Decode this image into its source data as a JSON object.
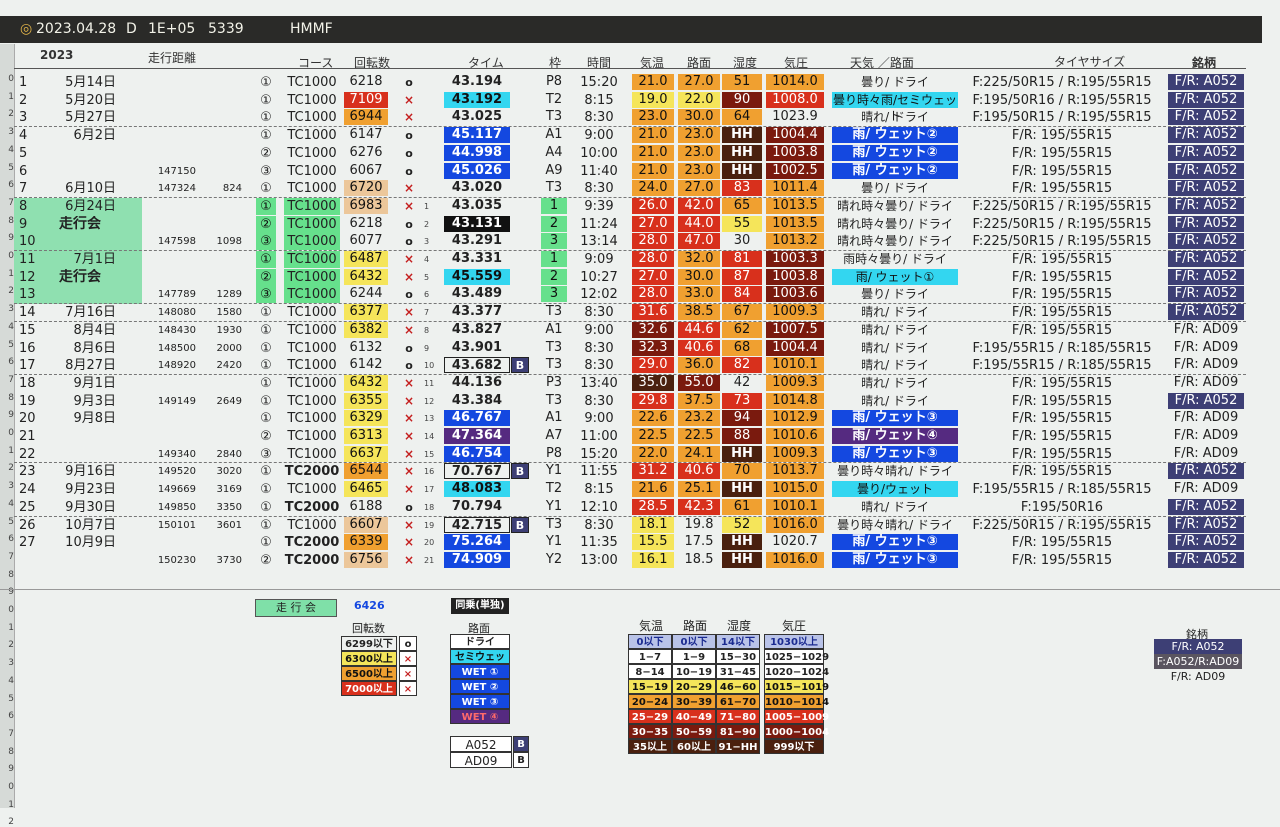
{
  "titlebar": {
    "date": "2023.04.28",
    "mode": "D",
    "value": "1E+05",
    "count": "5339",
    "car": "HMMF"
  },
  "headers": {
    "year": "2023",
    "distance": "走行距離",
    "course": "コース",
    "rpm": "回転数",
    "time": "タイム",
    "frame": "枠",
    "clock": "時間",
    "temp": "気温",
    "road": "路面",
    "humidity": "湿度",
    "pressure": "気圧",
    "weather": "天気 ／路面",
    "tire": "タイヤサイズ",
    "brand": "銘柄"
  },
  "colors": {
    "cyan": "#33d6f0",
    "blue": "#1448e0",
    "navy": "#3d3f75",
    "green": "#66e08c",
    "yellow": "#f5e55a",
    "orange": "#f0a030",
    "red": "#d8301c",
    "darkred": "#7a1a0e",
    "brown": "#4a200e",
    "purple": "#552a80",
    "black": "#111111",
    "tan": "#ecc79a"
  },
  "runs": [
    {
      "no": "1",
      "date": "5月14日",
      "dist": "",
      "dd": "",
      "lap": "①",
      "course": "TC1000",
      "rpm": "6218",
      "rpmc": "none",
      "mk": "o",
      "idx": "",
      "time": "43.194",
      "tc": "none",
      "b": "",
      "fr": "P8",
      "clock": "15:20",
      "temp": "21.0",
      "tpc": "orange",
      "road": "27.0",
      "rdc": "orange",
      "hum": "51",
      "hmc": "orange",
      "pres": "1014.0",
      "prc": "orange",
      "wx": "曇り/ ドライ",
      "wxc": "none",
      "tire": "F:225/50R15 / R:195/55R15",
      "brand": "F/R: A052",
      "bc": "navy"
    },
    {
      "no": "2",
      "date": "5月20日",
      "dist": "",
      "dd": "",
      "lap": "①",
      "course": "TC1000",
      "rpm": "7109",
      "rpmc": "red",
      "mk": "x",
      "idx": "",
      "time": "43.192",
      "tc": "cyan",
      "b": "",
      "fr": "T2",
      "clock": "8:15",
      "temp": "19.0",
      "tpc": "yellow",
      "road": "22.0",
      "rdc": "yellow",
      "hum": "90",
      "hmc": "darkred",
      "pres": "1008.0",
      "prc": "red",
      "wx": "曇り時々雨/セミウェット",
      "wxc": "cyan",
      "tire": "F:195/50R16 / R:195/55R15",
      "brand": "F/R: A052",
      "bc": "navy"
    },
    {
      "no": "3",
      "date": "5月27日",
      "dist": "",
      "dd": "",
      "lap": "①",
      "course": "TC1000",
      "rpm": "6944",
      "rpmc": "orange",
      "mk": "x",
      "idx": "",
      "time": "43.025",
      "tc": "none",
      "b": "",
      "fr": "T3",
      "clock": "8:30",
      "temp": "23.0",
      "tpc": "orange",
      "road": "30.0",
      "rdc": "orange",
      "hum": "64",
      "hmc": "orange",
      "pres": "1023.9",
      "prc": "none",
      "wx": "晴れ/ ドライ",
      "wxc": "none",
      "tire": "F:195/50R15 / R:195/55R15",
      "brand": "F/R: A052",
      "bc": "navy"
    },
    {
      "no": "4",
      "date": "6月2日",
      "dist": "",
      "dd": "",
      "lap": "①",
      "course": "TC1000",
      "rpm": "6147",
      "rpmc": "none",
      "mk": "o",
      "idx": "",
      "time": "45.117",
      "tc": "blue",
      "b": "",
      "fr": "A1",
      "clock": "9:00",
      "temp": "21.0",
      "tpc": "orange",
      "road": "23.0",
      "rdc": "orange",
      "hum": "HH",
      "hmc": "brown",
      "pres": "1004.4",
      "prc": "darkred",
      "wx": "雨/ ウェット②",
      "wxc": "blue",
      "tire": "F/R: 195/55R15",
      "brand": "F/R: A052",
      "bc": "navy"
    },
    {
      "no": "5",
      "date": "",
      "dist": "",
      "dd": "",
      "lap": "②",
      "course": "TC1000",
      "rpm": "6276",
      "rpmc": "none",
      "mk": "o",
      "idx": "",
      "time": "44.998",
      "tc": "blue",
      "b": "",
      "fr": "A4",
      "clock": "10:00",
      "temp": "21.0",
      "tpc": "orange",
      "road": "23.0",
      "rdc": "orange",
      "hum": "HH",
      "hmc": "brown",
      "pres": "1003.8",
      "prc": "darkred",
      "wx": "雨/ ウェット②",
      "wxc": "blue",
      "tire": "F/R: 195/55R15",
      "brand": "F/R: A052",
      "bc": "navy"
    },
    {
      "no": "6",
      "date": "",
      "dist": "147150",
      "dd": "",
      "lap": "③",
      "course": "TC1000",
      "rpm": "6067",
      "rpmc": "none",
      "mk": "o",
      "idx": "",
      "time": "45.026",
      "tc": "blue",
      "b": "",
      "fr": "A9",
      "clock": "11:40",
      "temp": "21.0",
      "tpc": "orange",
      "road": "23.0",
      "rdc": "orange",
      "hum": "HH",
      "hmc": "brown",
      "pres": "1002.5",
      "prc": "darkred",
      "wx": "雨/ ウェット②",
      "wxc": "blue",
      "tire": "F/R: 195/55R15",
      "brand": "F/R: A052",
      "bc": "navy"
    },
    {
      "no": "7",
      "date": "6月10日",
      "dist": "147324",
      "dd": "824",
      "lap": "①",
      "course": "TC1000",
      "rpm": "6720",
      "rpmc": "tan",
      "mk": "x",
      "idx": "",
      "time": "43.020",
      "tc": "none",
      "b": "",
      "fr": "T3",
      "clock": "8:30",
      "temp": "24.0",
      "tpc": "orange",
      "road": "27.0",
      "rdc": "orange",
      "hum": "83",
      "hmc": "red",
      "pres": "1011.4",
      "prc": "orange",
      "wx": "曇り/ ドライ",
      "wxc": "none",
      "tire": "F/R: 195/55R15",
      "brand": "F/R: A052",
      "bc": "navy"
    },
    {
      "no": "8",
      "date": "6月24日",
      "dist": "",
      "dd": "",
      "lap": "①",
      "course": "TC1000",
      "rpm": "6983",
      "rpmc": "tan",
      "mk": "x",
      "idx": "1",
      "time": "43.035",
      "tc": "none",
      "b": "",
      "fr": "1",
      "clock": "9:39",
      "temp": "26.0",
      "tpc": "red",
      "road": "42.0",
      "rdc": "red",
      "hum": "65",
      "hmc": "orange",
      "pres": "1013.5",
      "prc": "orange",
      "wx": "晴れ時々曇り/ ドライ",
      "wxc": "none",
      "tire": "F:225/50R15 / R:195/55R15",
      "brand": "F/R: A052",
      "bc": "navy"
    },
    {
      "no": "9",
      "date": "走行会",
      "dist": "",
      "dd": "",
      "lap": "②",
      "course": "TC1000",
      "rpm": "6218",
      "rpmc": "none",
      "mk": "o",
      "idx": "2",
      "time": "43.131",
      "tc": "black",
      "b": "",
      "fr": "2",
      "clock": "11:24",
      "temp": "27.0",
      "tpc": "red",
      "road": "44.0",
      "rdc": "red",
      "hum": "55",
      "hmc": "yellow",
      "pres": "1013.5",
      "prc": "orange",
      "wx": "晴れ時々曇り/ ドライ",
      "wxc": "none",
      "tire": "F:225/50R15 / R:195/55R15",
      "brand": "F/R: A052",
      "bc": "navy"
    },
    {
      "no": "10",
      "date": "",
      "dist": "147598",
      "dd": "1098",
      "lap": "③",
      "course": "TC1000",
      "rpm": "6077",
      "rpmc": "none",
      "mk": "o",
      "idx": "3",
      "time": "43.291",
      "tc": "none",
      "b": "",
      "fr": "3",
      "clock": "13:14",
      "temp": "28.0",
      "tpc": "red",
      "road": "47.0",
      "rdc": "red",
      "hum": "30",
      "hmc": "none",
      "pres": "1013.2",
      "prc": "orange",
      "wx": "晴れ時々曇り/ ドライ",
      "wxc": "none",
      "tire": "F:225/50R15 / R:195/55R15",
      "brand": "F/R: A052",
      "bc": "navy"
    },
    {
      "no": "11",
      "date": "7月1日",
      "dist": "",
      "dd": "",
      "lap": "①",
      "course": "TC1000",
      "rpm": "6487",
      "rpmc": "yellow",
      "mk": "x",
      "idx": "4",
      "time": "43.331",
      "tc": "none",
      "b": "",
      "fr": "1",
      "clock": "9:09",
      "temp": "28.0",
      "tpc": "red",
      "road": "32.0",
      "rdc": "orange",
      "hum": "81",
      "hmc": "red",
      "pres": "1003.3",
      "prc": "darkred",
      "wx": "雨時々曇り/ ドライ",
      "wxc": "none",
      "tire": "F/R: 195/55R15",
      "brand": "F/R: A052",
      "bc": "navy"
    },
    {
      "no": "12",
      "date": "走行会",
      "dist": "",
      "dd": "",
      "lap": "②",
      "course": "TC1000",
      "rpm": "6432",
      "rpmc": "yellow",
      "mk": "x",
      "idx": "5",
      "time": "45.559",
      "tc": "cyan",
      "b": "",
      "fr": "2",
      "clock": "10:27",
      "temp": "27.0",
      "tpc": "red",
      "road": "30.0",
      "rdc": "orange",
      "hum": "87",
      "hmc": "red",
      "pres": "1003.8",
      "prc": "darkred",
      "wx": "雨/ ウェット①",
      "wxc": "cyan",
      "tire": "F/R: 195/55R15",
      "brand": "F/R: A052",
      "bc": "navy"
    },
    {
      "no": "13",
      "date": "",
      "dist": "147789",
      "dd": "1289",
      "lap": "③",
      "course": "TC1000",
      "rpm": "6244",
      "rpmc": "none",
      "mk": "o",
      "idx": "6",
      "time": "43.489",
      "tc": "none",
      "b": "",
      "fr": "3",
      "clock": "12:02",
      "temp": "28.0",
      "tpc": "red",
      "road": "33.0",
      "rdc": "orange",
      "hum": "84",
      "hmc": "red",
      "pres": "1003.6",
      "prc": "darkred",
      "wx": "曇り/ ドライ",
      "wxc": "none",
      "tire": "F/R: 195/55R15",
      "brand": "F/R: A052",
      "bc": "navy"
    },
    {
      "no": "14",
      "date": "7月16日",
      "dist": "148080",
      "dd": "1580",
      "lap": "①",
      "course": "TC1000",
      "rpm": "6377",
      "rpmc": "yellow",
      "mk": "x",
      "idx": "7",
      "time": "43.377",
      "tc": "none",
      "b": "",
      "fr": "T3",
      "clock": "8:30",
      "temp": "31.6",
      "tpc": "red",
      "road": "38.5",
      "rdc": "orange",
      "hum": "67",
      "hmc": "orange",
      "pres": "1009.3",
      "prc": "orange",
      "wx": "晴れ/ ドライ",
      "wxc": "none",
      "tire": "F/R: 195/55R15",
      "brand": "F/R: A052",
      "bc": "navy"
    },
    {
      "no": "15",
      "date": "8月4日",
      "dist": "148430",
      "dd": "1930",
      "lap": "①",
      "course": "TC1000",
      "rpm": "6382",
      "rpmc": "yellow",
      "mk": "x",
      "idx": "8",
      "time": "43.827",
      "tc": "none",
      "b": "",
      "fr": "A1",
      "clock": "9:00",
      "temp": "32.6",
      "tpc": "darkred",
      "road": "44.6",
      "rdc": "red",
      "hum": "62",
      "hmc": "orange",
      "pres": "1007.5",
      "prc": "darkred",
      "wx": "晴れ/ ドライ",
      "wxc": "none",
      "tire": "F/R: 195/55R15",
      "brand": "F/R: AD09",
      "bc": "none"
    },
    {
      "no": "16",
      "date": "8月6日",
      "dist": "148500",
      "dd": "2000",
      "lap": "①",
      "course": "TC1000",
      "rpm": "6132",
      "rpmc": "none",
      "mk": "o",
      "idx": "9",
      "time": "43.901",
      "tc": "none",
      "b": "",
      "fr": "T3",
      "clock": "8:30",
      "temp": "32.3",
      "tpc": "darkred",
      "road": "40.6",
      "rdc": "red",
      "hum": "68",
      "hmc": "orange",
      "pres": "1004.4",
      "prc": "darkred",
      "wx": "晴れ/ ドライ",
      "wxc": "none",
      "tire": "F:195/55R15 / R:185/55R15",
      "brand": "F/R: AD09",
      "bc": "none"
    },
    {
      "no": "17",
      "date": "8月27日",
      "dist": "148920",
      "dd": "2420",
      "lap": "①",
      "course": "TC1000",
      "rpm": "6142",
      "rpmc": "none",
      "mk": "o",
      "idx": "10",
      "time": "43.682",
      "tc": "none",
      "b": "B",
      "fr": "T3",
      "clock": "8:30",
      "temp": "29.0",
      "tpc": "red",
      "road": "36.0",
      "rdc": "orange",
      "hum": "82",
      "hmc": "red",
      "pres": "1010.1",
      "prc": "orange",
      "wx": "晴れ/ ドライ",
      "wxc": "none",
      "tire": "F:195/55R15 / R:185/55R15",
      "brand": "F/R: AD09",
      "bc": "none"
    },
    {
      "no": "18",
      "date": "9月1日",
      "dist": "",
      "dd": "",
      "lap": "①",
      "course": "TC1000",
      "rpm": "6432",
      "rpmc": "yellow",
      "mk": "x",
      "idx": "11",
      "time": "44.136",
      "tc": "none",
      "b": "",
      "fr": "P3",
      "clock": "13:40",
      "temp": "35.0",
      "tpc": "brown",
      "road": "55.0",
      "rdc": "darkred",
      "hum": "42",
      "hmc": "none",
      "pres": "1009.3",
      "prc": "orange",
      "wx": "晴れ/ ドライ",
      "wxc": "none",
      "tire": "F/R: 195/55R15",
      "brand": "F/R: AD09",
      "bc": "none"
    },
    {
      "no": "19",
      "date": "9月3日",
      "dist": "149149",
      "dd": "2649",
      "lap": "①",
      "course": "TC1000",
      "rpm": "6355",
      "rpmc": "yellow",
      "mk": "x",
      "idx": "12",
      "time": "43.384",
      "tc": "none",
      "b": "",
      "fr": "T3",
      "clock": "8:30",
      "temp": "29.8",
      "tpc": "red",
      "road": "37.5",
      "rdc": "orange",
      "hum": "73",
      "hmc": "red",
      "pres": "1014.8",
      "prc": "orange",
      "wx": "晴れ/ ドライ",
      "wxc": "none",
      "tire": "F/R: 195/55R15",
      "brand": "F/R: A052",
      "bc": "navy"
    },
    {
      "no": "20",
      "date": "9月8日",
      "dist": "",
      "dd": "",
      "lap": "①",
      "course": "TC1000",
      "rpm": "6329",
      "rpmc": "yellow",
      "mk": "x",
      "idx": "13",
      "time": "46.767",
      "tc": "blue",
      "b": "",
      "fr": "A1",
      "clock": "9:00",
      "temp": "22.6",
      "tpc": "orange",
      "road": "23.2",
      "rdc": "orange",
      "hum": "94",
      "hmc": "darkred",
      "pres": "1012.9",
      "prc": "orange",
      "wx": "雨/ ウェット③",
      "wxc": "blue",
      "tire": "F/R: 195/55R15",
      "brand": "F/R: AD09",
      "bc": "none"
    },
    {
      "no": "21",
      "date": "",
      "dist": "",
      "dd": "",
      "lap": "②",
      "course": "TC1000",
      "rpm": "6313",
      "rpmc": "yellow",
      "mk": "x",
      "idx": "14",
      "time": "47.364",
      "tc": "purple",
      "b": "",
      "fr": "A7",
      "clock": "11:00",
      "temp": "22.5",
      "tpc": "orange",
      "road": "22.5",
      "rdc": "orange",
      "hum": "88",
      "hmc": "darkred",
      "pres": "1010.6",
      "prc": "orange",
      "wx": "雨/ ウェット④",
      "wxc": "purple",
      "tire": "F/R: 195/55R15",
      "brand": "F/R: AD09",
      "bc": "none"
    },
    {
      "no": "22",
      "date": "",
      "dist": "149340",
      "dd": "2840",
      "lap": "③",
      "course": "TC1000",
      "rpm": "6637",
      "rpmc": "yellow",
      "mk": "x",
      "idx": "15",
      "time": "46.754",
      "tc": "blue",
      "b": "",
      "fr": "P8",
      "clock": "15:20",
      "temp": "22.0",
      "tpc": "orange",
      "road": "24.1",
      "rdc": "orange",
      "hum": "HH",
      "hmc": "brown",
      "pres": "1009.3",
      "prc": "orange",
      "wx": "雨/ ウェット③",
      "wxc": "blue",
      "tire": "F/R: 195/55R15",
      "brand": "F/R: AD09",
      "bc": "none"
    },
    {
      "no": "23",
      "date": "9月16日",
      "dist": "149520",
      "dd": "3020",
      "lap": "①",
      "course": "TC2000",
      "rpm": "6544",
      "rpmc": "orange",
      "mk": "x",
      "idx": "16",
      "time": "70.767",
      "tc": "none",
      "b": "B",
      "fr": "Y1",
      "clock": "11:55",
      "temp": "31.2",
      "tpc": "red",
      "road": "40.6",
      "rdc": "red",
      "hum": "70",
      "hmc": "orange",
      "pres": "1013.7",
      "prc": "orange",
      "wx": "曇り時々晴れ/ ドライ",
      "wxc": "none",
      "tire": "F/R: 195/55R15",
      "brand": "F/R: A052",
      "bc": "navy"
    },
    {
      "no": "24",
      "date": "9月23日",
      "dist": "149669",
      "dd": "3169",
      "lap": "①",
      "course": "TC1000",
      "rpm": "6465",
      "rpmc": "yellow",
      "mk": "x",
      "idx": "17",
      "time": "48.083",
      "tc": "cyan",
      "b": "",
      "fr": "T2",
      "clock": "8:15",
      "temp": "21.6",
      "tpc": "orange",
      "road": "25.1",
      "rdc": "orange",
      "hum": "HH",
      "hmc": "brown",
      "pres": "1015.0",
      "prc": "orange",
      "wx": "曇り/ウェット",
      "wxc": "cyan",
      "tire": "F:195/55R15 / R:185/55R15",
      "brand": "F/R: AD09",
      "bc": "none"
    },
    {
      "no": "25",
      "date": "9月30日",
      "dist": "149850",
      "dd": "3350",
      "lap": "①",
      "course": "TC2000",
      "rpm": "6188",
      "rpmc": "none",
      "mk": "o",
      "idx": "18",
      "time": "70.794",
      "tc": "none",
      "b": "",
      "fr": "Y1",
      "clock": "12:10",
      "temp": "28.5",
      "tpc": "red",
      "road": "42.3",
      "rdc": "red",
      "hum": "61",
      "hmc": "orange",
      "pres": "1010.1",
      "prc": "orange",
      "wx": "晴れ/ ドライ",
      "wxc": "none",
      "tire": "F:195/50R16",
      "brand": "F/R: A052",
      "bc": "navy"
    },
    {
      "no": "26",
      "date": "10月7日",
      "dist": "150101",
      "dd": "3601",
      "lap": "①",
      "course": "TC1000",
      "rpm": "6607",
      "rpmc": "tan",
      "mk": "x",
      "idx": "19",
      "time": "42.715",
      "tc": "none",
      "b": "B",
      "fr": "T3",
      "clock": "8:30",
      "temp": "18.1",
      "tpc": "yellow",
      "road": "19.8",
      "rdc": "none",
      "hum": "52",
      "hmc": "yellow",
      "pres": "1016.0",
      "prc": "orange",
      "wx": "曇り時々晴れ/ ドライ",
      "wxc": "none",
      "tire": "F:225/50R15 / R:195/55R15",
      "brand": "F/R: A052",
      "bc": "navy"
    },
    {
      "no": "27",
      "date": "10月9日",
      "dist": "",
      "dd": "",
      "lap": "①",
      "course": "TC2000",
      "rpm": "6339",
      "rpmc": "orange",
      "mk": "x",
      "idx": "20",
      "time": "75.264",
      "tc": "blue",
      "b": "",
      "fr": "Y1",
      "clock": "11:35",
      "temp": "15.5",
      "tpc": "yellow",
      "road": "17.5",
      "rdc": "none",
      "hum": "HH",
      "hmc": "brown",
      "pres": "1020.7",
      "prc": "none",
      "wx": "雨/ ウェット③",
      "wxc": "blue",
      "tire": "F/R: 195/55R15",
      "brand": "F/R: A052",
      "bc": "navy"
    },
    {
      "no": "",
      "date": "",
      "dist": "150230",
      "dd": "3730",
      "lap": "②",
      "course": "TC2000",
      "rpm": "6756",
      "rpmc": "tan",
      "mk": "x",
      "idx": "21",
      "time": "74.909",
      "tc": "blue",
      "b": "",
      "fr": "Y2",
      "clock": "13:00",
      "temp": "16.1",
      "tpc": "yellow",
      "road": "18.5",
      "rdc": "none",
      "hum": "HH",
      "hmc": "brown",
      "pres": "1016.0",
      "prc": "orange",
      "wx": "雨/ ウェット③",
      "wxc": "blue",
      "tire": "F/R: 195/55R15",
      "brand": "F/R: A052",
      "bc": "navy"
    }
  ],
  "legend": {
    "event_label": "走 行 会",
    "event_value": "6426",
    "same_ride": "同乗(単独)",
    "rpm_title": "回転数",
    "rpm_items": [
      {
        "t": "6299以下",
        "m": "o"
      },
      {
        "t": "6300以上",
        "m": "x"
      },
      {
        "t": "6500以上",
        "m": "x"
      },
      {
        "t": "7000以上",
        "m": "x"
      }
    ],
    "road_title": "路面",
    "road_items": [
      "ドライ",
      "セミウェット",
      "WET ①",
      "WET ②",
      "WET ③",
      "WET ④"
    ],
    "tires": [
      {
        "t": "A052",
        "b": "B"
      },
      {
        "t": "AD09",
        "b": "B"
      }
    ],
    "cond_headers": [
      "気温",
      "路面",
      "湿度",
      "気圧"
    ],
    "cond_rows": [
      [
        "0以下",
        "0以下",
        "14以下",
        "1030以上"
      ],
      [
        "1−7",
        "1−9",
        "15−30",
        "1025−1029"
      ],
      [
        "8−14",
        "10−19",
        "31−45",
        "1020−1024"
      ],
      [
        "15−19",
        "20−29",
        "46−60",
        "1015−1019"
      ],
      [
        "20−24",
        "30−39",
        "61−70",
        "1010−1014"
      ],
      [
        "25−29",
        "40−49",
        "71−80",
        "1005−1009"
      ],
      [
        "30−35",
        "50−59",
        "81−90",
        "1000−1004"
      ],
      [
        "35以上",
        "60以上",
        "91−HH",
        "999以下"
      ]
    ],
    "brand_title": "銘柄",
    "brand_items": [
      "F/R: A052",
      "F:A052/R:AD09",
      "F/R: AD09"
    ]
  }
}
